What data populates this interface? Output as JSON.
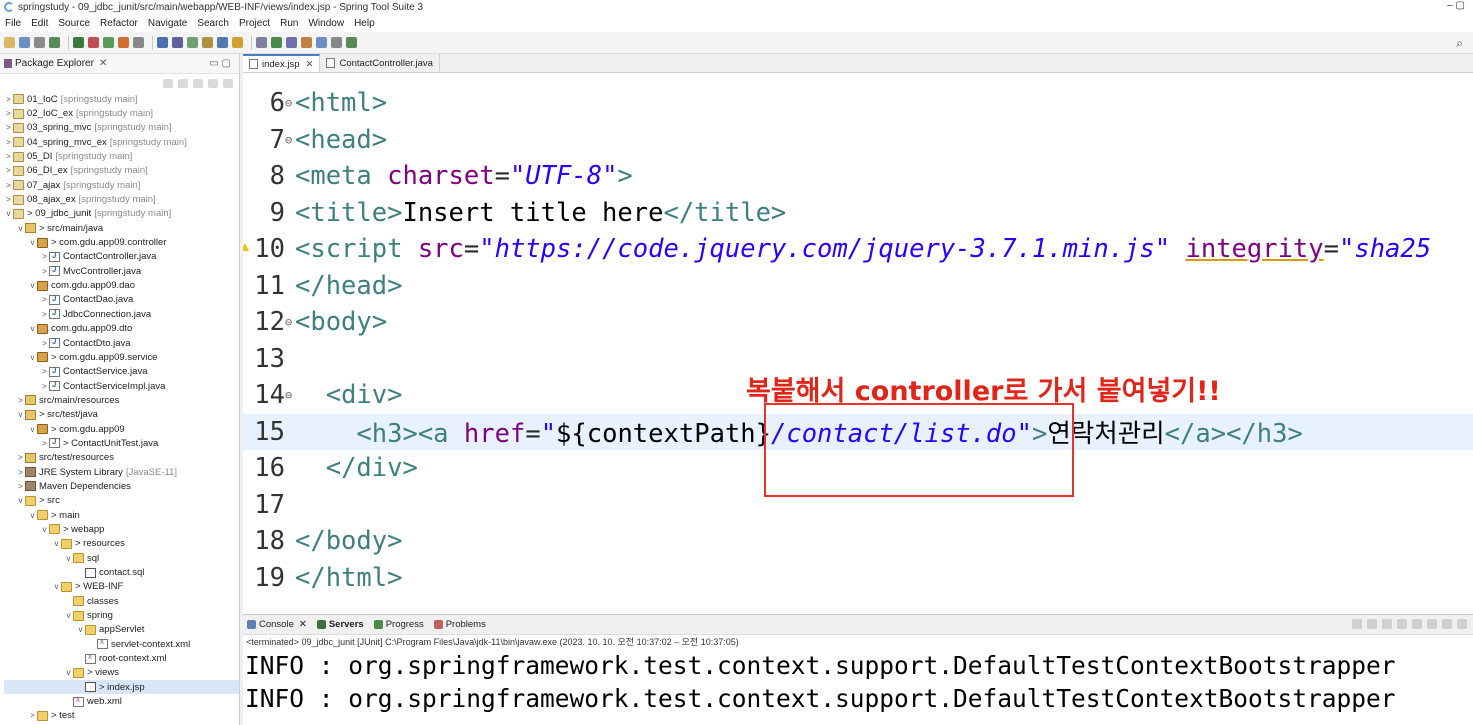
{
  "window": {
    "title": "springstudy - 09_jdbc_junit/src/main/webapp/WEB-INF/views/index.jsp - Spring Tool Suite 3",
    "controls": "– ▢"
  },
  "menu": [
    "File",
    "Edit",
    "Source",
    "Refactor",
    "Navigate",
    "Search",
    "Project",
    "Run",
    "Window",
    "Help"
  ],
  "package_explorer": {
    "title": "Package Explorer",
    "tree": [
      {
        "indent": 0,
        "arrow": ">",
        "icon": "proj",
        "label": "01_IoC",
        "deco": "[springstudy main]"
      },
      {
        "indent": 0,
        "arrow": ">",
        "icon": "proj",
        "label": "02_IoC_ex",
        "deco": "[springstudy main]"
      },
      {
        "indent": 0,
        "arrow": ">",
        "icon": "proj",
        "label": "03_spring_mvc",
        "deco": "[springstudy main]"
      },
      {
        "indent": 0,
        "arrow": ">",
        "icon": "proj",
        "label": "04_spring_mvc_ex",
        "deco": "[springstudy main]"
      },
      {
        "indent": 0,
        "arrow": ">",
        "icon": "proj",
        "label": "05_DI",
        "deco": "[springstudy main]"
      },
      {
        "indent": 0,
        "arrow": ">",
        "icon": "proj",
        "label": "06_DI_ex",
        "deco": "[springstudy main]"
      },
      {
        "indent": 0,
        "arrow": ">",
        "icon": "proj",
        "label": "07_ajax",
        "deco": "[springstudy main]"
      },
      {
        "indent": 0,
        "arrow": ">",
        "icon": "proj",
        "label": "08_ajax_ex",
        "deco": "[springstudy main]"
      },
      {
        "indent": 0,
        "arrow": "v",
        "icon": "proj",
        "label": "> 09_jdbc_junit",
        "deco": "[springstudy main]"
      },
      {
        "indent": 1,
        "arrow": "v",
        "icon": "src",
        "label": "> src/main/java",
        "deco": ""
      },
      {
        "indent": 2,
        "arrow": "v",
        "icon": "pkgi",
        "label": "> com.gdu.app09.controller",
        "deco": ""
      },
      {
        "indent": 3,
        "arrow": ">",
        "icon": "java",
        "label": "ContactController.java",
        "deco": ""
      },
      {
        "indent": 3,
        "arrow": ">",
        "icon": "java",
        "label": "MvcController.java",
        "deco": ""
      },
      {
        "indent": 2,
        "arrow": "v",
        "icon": "pkgi",
        "label": "com.gdu.app09.dao",
        "deco": ""
      },
      {
        "indent": 3,
        "arrow": ">",
        "icon": "java",
        "label": "ContactDao.java",
        "deco": ""
      },
      {
        "indent": 3,
        "arrow": ">",
        "icon": "java",
        "label": "JdbcConnection.java",
        "deco": ""
      },
      {
        "indent": 2,
        "arrow": "v",
        "icon": "pkgi",
        "label": "com.gdu.app09.dto",
        "deco": ""
      },
      {
        "indent": 3,
        "arrow": ">",
        "icon": "java",
        "label": "ContactDto.java",
        "deco": ""
      },
      {
        "indent": 2,
        "arrow": "v",
        "icon": "pkgi",
        "label": "> com.gdu.app09.service",
        "deco": ""
      },
      {
        "indent": 3,
        "arrow": ">",
        "icon": "java",
        "label": "ContactService.java",
        "deco": ""
      },
      {
        "indent": 3,
        "arrow": ">",
        "icon": "java",
        "label": "ContactServiceImpl.java",
        "deco": ""
      },
      {
        "indent": 1,
        "arrow": ">",
        "icon": "src",
        "label": "src/main/resources",
        "deco": ""
      },
      {
        "indent": 1,
        "arrow": "v",
        "icon": "src",
        "label": "> src/test/java",
        "deco": ""
      },
      {
        "indent": 2,
        "arrow": "v",
        "icon": "pkgi",
        "label": "> com.gdu.app09",
        "deco": ""
      },
      {
        "indent": 3,
        "arrow": ">",
        "icon": "java",
        "label": "> ContactUnitTest.java",
        "deco": ""
      },
      {
        "indent": 1,
        "arrow": ">",
        "icon": "src",
        "label": "src/test/resources",
        "deco": ""
      },
      {
        "indent": 1,
        "arrow": ">",
        "icon": "lib",
        "label": "JRE System Library",
        "deco": "[JavaSE-11]"
      },
      {
        "indent": 1,
        "arrow": ">",
        "icon": "lib",
        "label": "Maven Dependencies",
        "deco": ""
      },
      {
        "indent": 1,
        "arrow": "v",
        "icon": "folder",
        "label": "> src",
        "deco": ""
      },
      {
        "indent": 2,
        "arrow": "v",
        "icon": "folder",
        "label": "> main",
        "deco": ""
      },
      {
        "indent": 3,
        "arrow": "v",
        "icon": "folder",
        "label": "> webapp",
        "deco": ""
      },
      {
        "indent": 4,
        "arrow": "v",
        "icon": "folder",
        "label": "> resources",
        "deco": ""
      },
      {
        "indent": 5,
        "arrow": "v",
        "icon": "folder",
        "label": "sql",
        "deco": ""
      },
      {
        "indent": 6,
        "arrow": "",
        "icon": "file",
        "label": "contact.sql",
        "deco": ""
      },
      {
        "indent": 4,
        "arrow": "v",
        "icon": "folder",
        "label": "> WEB-INF",
        "deco": ""
      },
      {
        "indent": 5,
        "arrow": "",
        "icon": "folder",
        "label": "classes",
        "deco": ""
      },
      {
        "indent": 5,
        "arrow": "v",
        "icon": "folder",
        "label": "spring",
        "deco": ""
      },
      {
        "indent": 6,
        "arrow": "v",
        "icon": "folder",
        "label": "appServlet",
        "deco": ""
      },
      {
        "indent": 7,
        "arrow": "",
        "icon": "xml",
        "label": "servlet-context.xml",
        "deco": ""
      },
      {
        "indent": 6,
        "arrow": "",
        "icon": "xml",
        "label": "root-context.xml",
        "deco": ""
      },
      {
        "indent": 5,
        "arrow": "v",
        "icon": "folder",
        "label": "> views",
        "deco": ""
      },
      {
        "indent": 6,
        "arrow": "",
        "icon": "file",
        "label": "> index.jsp",
        "deco": "",
        "selected": true
      },
      {
        "indent": 5,
        "arrow": "",
        "icon": "xml",
        "label": "web.xml",
        "deco": ""
      },
      {
        "indent": 2,
        "arrow": ">",
        "icon": "folder",
        "label": "> test",
        "deco": ""
      }
    ]
  },
  "editor": {
    "tabs": [
      {
        "label": "index.jsp",
        "active": true,
        "close": "✕"
      },
      {
        "label": "ContactController.java",
        "active": false,
        "close": ""
      }
    ],
    "lines": [
      {
        "num": "6",
        "fold": "⊖",
        "html": "<span class='tagc'>&lt;html&gt;</span>"
      },
      {
        "num": "7",
        "fold": "⊖",
        "html": "<span class='tagc'>&lt;head&gt;</span>"
      },
      {
        "num": "8",
        "fold": "",
        "html": "<span class='tagc'>&lt;meta</span> <span class='attrc'>charset</span>=<span class='strc'>\"UTF-8\"</span><span class='tagc'>&gt;</span>"
      },
      {
        "num": "9",
        "fold": "",
        "html": "<span class='tagc'>&lt;title&gt;</span><span class='textc'>Insert title here</span><span class='tagc'>&lt;/title&gt;</span>"
      },
      {
        "num": "10",
        "fold": "",
        "warn": true,
        "html": "<span class='tagc'>&lt;script</span> <span class='attrc'>src</span>=<span class='strc'>\"https://code.jquery.com/jquery-3.7.1.min.js\"</span> <span class='attrc' style='text-decoration:underline #d4a000'>integrity</span>=<span class='strc'>\"sha25</span>"
      },
      {
        "num": "11",
        "fold": "",
        "html": "<span class='tagc'>&lt;/head&gt;</span>"
      },
      {
        "num": "12",
        "fold": "⊖",
        "html": "<span class='tagc'>&lt;body&gt;</span>"
      },
      {
        "num": "13",
        "fold": "",
        "html": ""
      },
      {
        "num": "14",
        "fold": "⊖",
        "html": "  <span class='tagc'>&lt;div&gt;</span>"
      },
      {
        "num": "15",
        "fold": "",
        "current": true,
        "html": "    <span class='tagc'>&lt;h3&gt;&lt;a</span> <span class='attrc'>href</span>=<span class='strc'>\"</span><span class='textc'>${contextPath}</span><span class='strc'>/contact/list.do\"</span><span class='tagc'>&gt;</span><span class='textc'>연락처관리</span><span class='tagc'>&lt;/a&gt;&lt;/h3&gt;</span>"
      },
      {
        "num": "16",
        "fold": "",
        "html": "  <span class='tagc'>&lt;/div&gt;</span>"
      },
      {
        "num": "17",
        "fold": "",
        "html": ""
      },
      {
        "num": "18",
        "fold": "",
        "html": "<span class='tagc'>&lt;/body&gt;</span>"
      },
      {
        "num": "19",
        "fold": "",
        "html": "<span class='tagc'>&lt;/html&gt;</span>"
      }
    ],
    "annotation": "복붙해서 controller로 가서 붙여넣기!!"
  },
  "console": {
    "tabs": [
      {
        "label": "Console",
        "color": "#5a7fb0",
        "close": "✕"
      },
      {
        "label": "Servers",
        "color": "#3f6f3f",
        "bold": true
      },
      {
        "label": "Progress",
        "color": "#4a8a4a"
      },
      {
        "label": "Problems",
        "color": "#c06060"
      }
    ],
    "terminated": "<terminated> 09_jdbc_junit [JUnit] C:\\Program Files\\Java\\jdk-11\\bin\\javaw.exe (2023. 10. 10. 오전 10:37:02 – 오전 10:37:05)",
    "lines": [
      "INFO : org.springframework.test.context.support.DefaultTestContextBootstrapper",
      "INFO : org.springframework.test.context.support.DefaultTestContextBootstrapper"
    ]
  }
}
